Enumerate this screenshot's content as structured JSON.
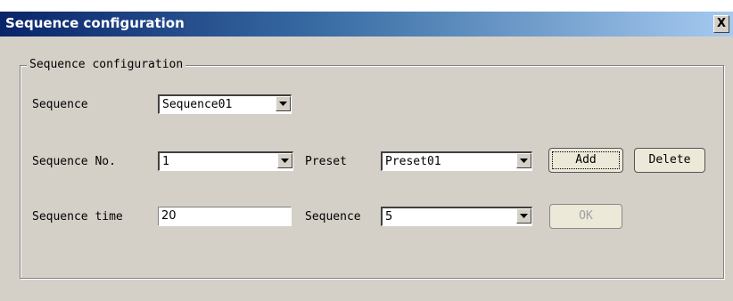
{
  "window": {
    "title": "Sequence configuration",
    "close_label": "X"
  },
  "group": {
    "legend": "Sequence configuration"
  },
  "row1": {
    "sequence_label": "Sequence",
    "sequence_value": "Sequence01"
  },
  "row2": {
    "sequence_no_label": "Sequence No.",
    "sequence_no_value": "1",
    "preset_label": "Preset",
    "preset_value": "Preset01",
    "add_label": "Add",
    "delete_label": "Delete"
  },
  "row3": {
    "sequence_time_label": "Sequence time",
    "sequence_time_value": "20",
    "sequence_label": "Sequence",
    "sequence_value": "5",
    "ok_label": "OK"
  },
  "icons": [
    "close-icon",
    "chevron-down-icon"
  ],
  "colors": {
    "title_start": "#0a246a",
    "title_end": "#a6caf0",
    "dialog_bg": "#d4d0c8"
  }
}
